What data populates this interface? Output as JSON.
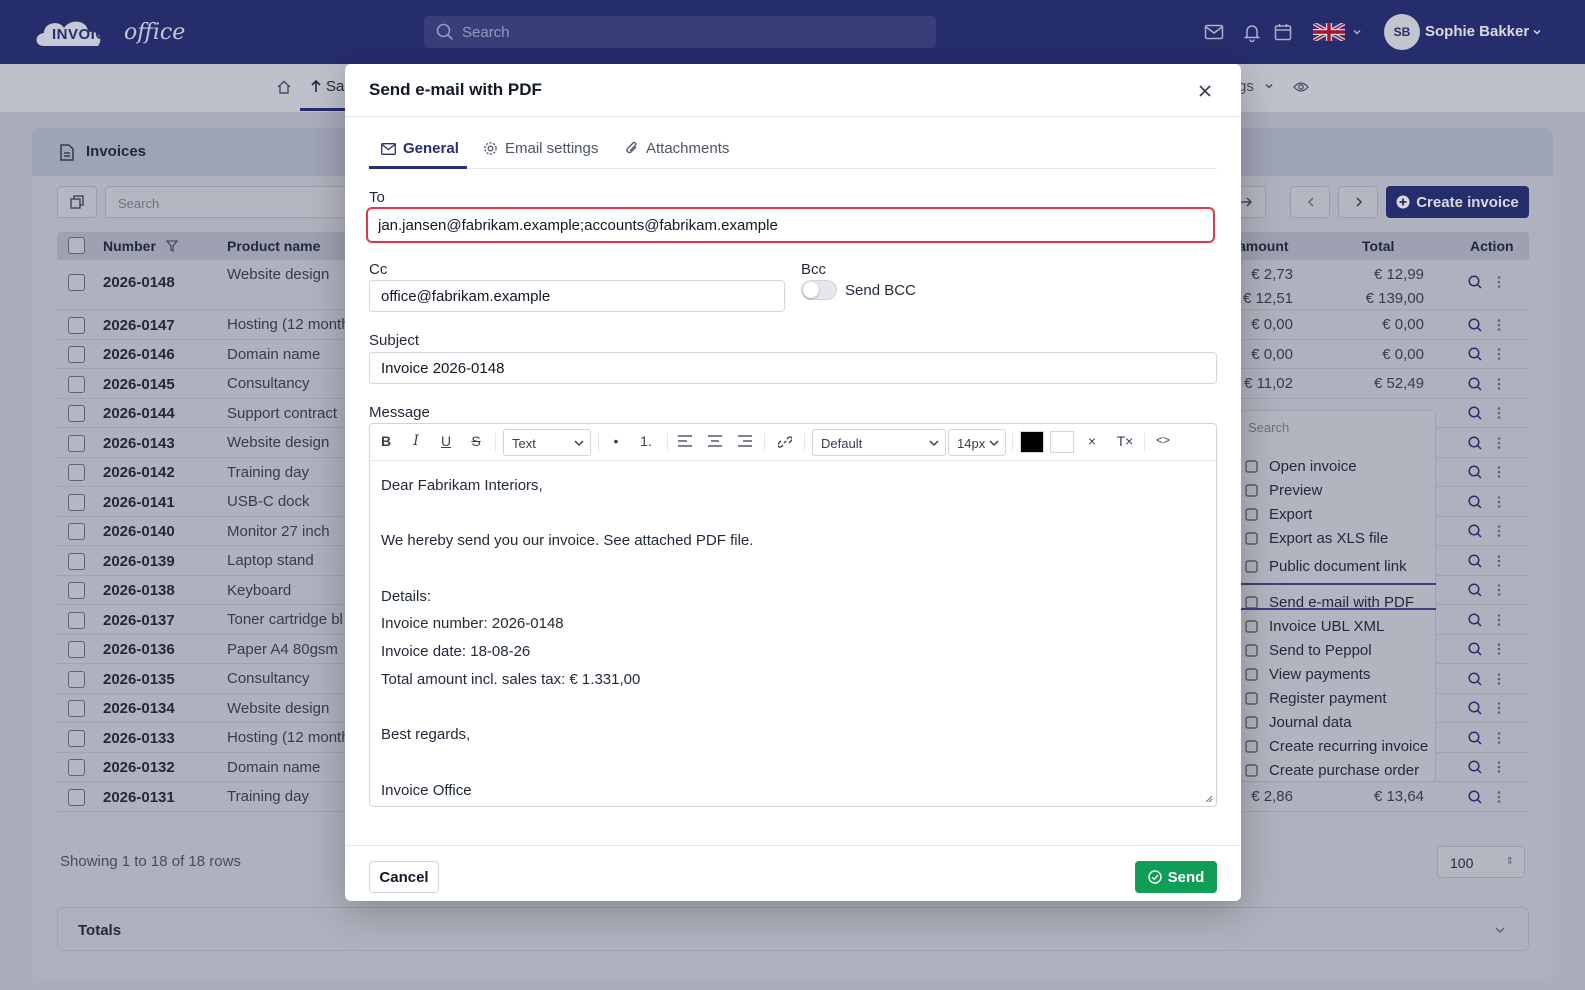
{
  "app": {
    "logo_text_1": "INVOICE",
    "logo_text_2": "office",
    "search_placeholder": "Search",
    "user_initials": "SB",
    "user_name": "Sophie Bakker"
  },
  "subnav": {
    "active_label": "Sa",
    "settings_label": "gs"
  },
  "invoices_card": {
    "title": "Invoices",
    "search_placeholder": "Search",
    "create_label": "Create invoice",
    "columns": {
      "number": "Number",
      "product": "Product name",
      "amount": "amount",
      "total": "Total",
      "action": "Action"
    },
    "rows": [
      {
        "number": "2026-0148",
        "product": "Website design",
        "amount": "€ 2,73",
        "total": "€ 12,99",
        "amount2": "€ 12,51",
        "total2": "€ 139,00"
      },
      {
        "number": "2026-0147",
        "product": "Hosting (12 month",
        "amount": "€ 0,00",
        "total": "€ 0,00"
      },
      {
        "number": "2026-0146",
        "product": "Domain name",
        "amount": "€ 0,00",
        "total": "€ 0,00"
      },
      {
        "number": "2026-0145",
        "product": "Consultancy",
        "amount": "€ 11,02",
        "total": "€ 52,49"
      },
      {
        "number": "2026-0144",
        "product": "Support contract",
        "amount": "",
        "total": ""
      },
      {
        "number": "2026-0143",
        "product": "Website design",
        "amount": "",
        "total": ""
      },
      {
        "number": "2026-0142",
        "product": "Training day",
        "amount": "",
        "total": ""
      },
      {
        "number": "2026-0141",
        "product": "USB-C dock",
        "amount": "",
        "total": ""
      },
      {
        "number": "2026-0140",
        "product": "Monitor 27 inch",
        "amount": "",
        "total": ""
      },
      {
        "number": "2026-0139",
        "product": "Laptop stand",
        "amount": "",
        "total": ""
      },
      {
        "number": "2026-0138",
        "product": "Keyboard",
        "amount": "",
        "total": ""
      },
      {
        "number": "2026-0137",
        "product": "Toner cartridge bl",
        "amount": "",
        "total": ""
      },
      {
        "number": "2026-0136",
        "product": "Paper A4 80gsm",
        "amount": "",
        "total": ""
      },
      {
        "number": "2026-0135",
        "product": "Consultancy",
        "amount": "",
        "total": ""
      },
      {
        "number": "2026-0134",
        "product": "Website design",
        "amount": "",
        "total": ""
      },
      {
        "number": "2026-0133",
        "product": "Hosting (12 month",
        "amount": "",
        "total": ""
      },
      {
        "number": "2026-0132",
        "product": "Domain name",
        "amount": "",
        "total": ""
      },
      {
        "number": "2026-0131",
        "product": "Training day",
        "amount": "€ 2,86",
        "total": "€ 13,64"
      }
    ],
    "showing_text": "Showing 1 to 18 of 18 rows",
    "page_size": "100",
    "totals_label": "Totals"
  },
  "action_menu": {
    "search_placeholder": "Search",
    "items": [
      {
        "label": "Open invoice",
        "icon": "document-icon"
      },
      {
        "label": "Preview",
        "icon": "eye-icon"
      },
      {
        "label": "Export",
        "icon": "download-icon"
      },
      {
        "label": "Export as XLS file",
        "icon": "spreadsheet-icon"
      },
      {
        "label": "Public document link",
        "icon": "link-icon"
      },
      {
        "label": "Send e-mail with PDF",
        "icon": "mail-icon"
      },
      {
        "label": "Invoice UBL XML",
        "icon": "file-icon"
      },
      {
        "label": "Send to Peppol",
        "icon": "send-icon"
      },
      {
        "label": "View payments",
        "icon": "payments-icon"
      },
      {
        "label": "Register payment",
        "icon": "card-icon"
      },
      {
        "label": "Journal data",
        "icon": "book-icon"
      },
      {
        "label": "Create recurring invoice",
        "icon": "refresh-icon"
      },
      {
        "label": "Create purchase order",
        "icon": "cart-icon"
      }
    ]
  },
  "modal": {
    "title": "Send e-mail with PDF",
    "tabs": [
      "General",
      "Email settings",
      "Attachments"
    ],
    "to_label": "To",
    "to_value": "jan.jansen@fabrikam.example;accounts@fabrikam.example",
    "cc_label": "Cc",
    "cc_value": "office@fabrikam.example",
    "bcc_label": "Bcc",
    "bcc_toggle_label": "Send BCC",
    "subject_label": "Subject",
    "subject_value": "Invoice 2026-0148",
    "message_label": "Message",
    "toolbar": {
      "bold": "B",
      "italic": "I",
      "underline": "U",
      "strike": "S",
      "text_style": "Text",
      "bullet": "•",
      "ordered": "1.",
      "font": "Default",
      "size": "14px",
      "color_text": "#000000",
      "color_bg": "#ffffff",
      "clear": "×",
      "clear_format": "T×",
      "code": "<>"
    },
    "message_lines": [
      "Dear Fabrikam Interiors,",
      "",
      "We hereby send you our invoice. See attached PDF file.",
      "",
      "Details:",
      "Invoice number: 2026-0148",
      "Invoice date: 18-08-26",
      "Total amount incl. sales tax: € 1.331,00",
      "",
      "Best regards,",
      "",
      "Invoice Office"
    ],
    "cancel_label": "Cancel",
    "send_label": "Send"
  },
  "colors": {
    "brand": "#272e75",
    "focus_border": "#e0384a",
    "send_green": "#0f9d58"
  }
}
